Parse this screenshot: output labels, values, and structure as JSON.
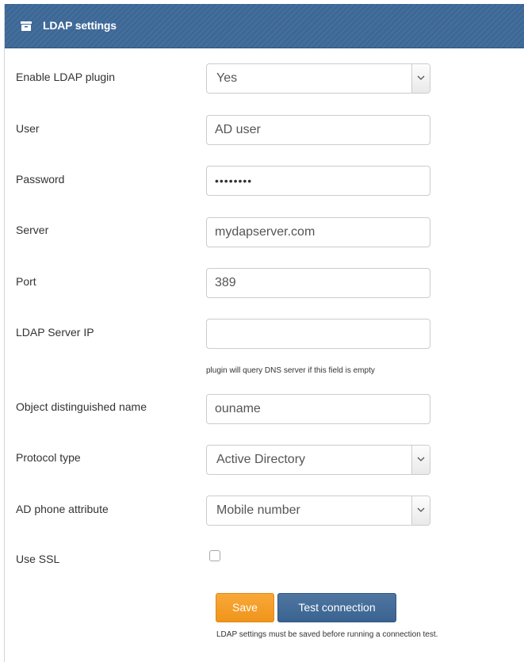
{
  "panel": {
    "title": "LDAP settings",
    "icon": "archive-box-icon"
  },
  "fields": {
    "enable_plugin": {
      "label": "Enable LDAP plugin",
      "value": "Yes"
    },
    "user": {
      "label": "User",
      "value": "AD user"
    },
    "password": {
      "label": "Password",
      "value": "••••••••"
    },
    "server": {
      "label": "Server",
      "value": "mydapserver.com"
    },
    "port": {
      "label": "Port",
      "value": "389"
    },
    "server_ip": {
      "label": "LDAP Server IP",
      "value": "",
      "hint": "plugin will query DNS server if this field is empty"
    },
    "object_dn": {
      "label": "Object distinguished name",
      "value": "ouname"
    },
    "protocol": {
      "label": "Protocol type",
      "value": "Active Directory"
    },
    "phone_attr": {
      "label": "AD phone attribute",
      "value": "Mobile number"
    },
    "use_ssl": {
      "label": "Use SSL",
      "checked": false
    }
  },
  "actions": {
    "save_label": "Save",
    "test_label": "Test connection",
    "note": "LDAP settings must be saved before running a connection test."
  },
  "colors": {
    "header": "#3c6796",
    "save_button": "#f39d26",
    "test_button": "#436c98"
  }
}
